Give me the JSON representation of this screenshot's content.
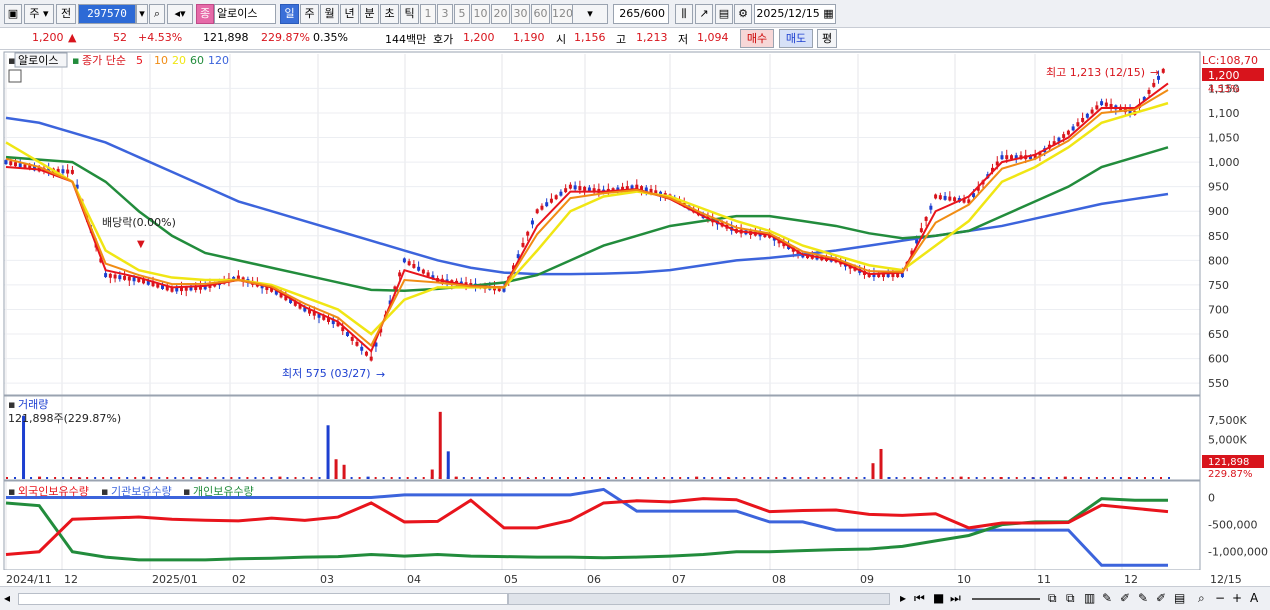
{
  "toolbar": {
    "market": "주",
    "prefix": "전",
    "code": "297570",
    "badge": "종",
    "stock_name": "알로이스",
    "periods": [
      "일",
      "주",
      "월",
      "년",
      "분",
      "초",
      "틱"
    ],
    "active_period": "일",
    "intervals": [
      "1",
      "3",
      "5",
      "10",
      "20",
      "30",
      "60",
      "120"
    ],
    "count": "265",
    "total": "/600",
    "date": "2025/12/15"
  },
  "quote": {
    "price": "1,200",
    "arrow": "▲",
    "change": "52",
    "change_pct": "+4.53%",
    "volume": "121,898",
    "volume_ratio": "229.87%",
    "turnover": "0.35%",
    "amount": "144백만",
    "ask_label": "호가",
    "ask": "1,200",
    "bid": "1,190",
    "open_label": "시",
    "open": "1,156",
    "high_label": "고",
    "high": "1,213",
    "low_label": "저",
    "low": "1,094",
    "buy_label": "매수",
    "sell_label": "매도",
    "eval_label": "평"
  },
  "price_panel": {
    "name": "알로이스",
    "indicator": "종가 단순",
    "ma_periods": [
      "5",
      "10",
      "20",
      "60",
      "120"
    ],
    "ma_colors": [
      "#e8141c",
      "#f08c14",
      "#f0e614",
      "#228c3c",
      "#3c64dc"
    ],
    "lc": "LC:108,70",
    "current": "1,200",
    "current_pct": "4.53%",
    "high_note": "최고 1,213 (12/15)",
    "low_note": "최저 575 (03/27)",
    "dividend_note": "배당락(0.00%)",
    "y_ticks": [
      "1,150",
      "1,100",
      "1,050",
      "1,000",
      "950",
      "900",
      "850",
      "800",
      "750",
      "700",
      "650",
      "600",
      "550"
    ]
  },
  "volume_panel": {
    "title": "거래량",
    "value": "121,898주(229.87%)",
    "y_ticks": [
      "7,500K",
      "5,000K",
      "2,500K"
    ],
    "current": "121,898",
    "current_pct": "229.87%"
  },
  "holdings_panel": {
    "legend": [
      "외국인보유수량",
      "기관보유수량",
      "개인보유수량"
    ],
    "colors": [
      "#e8141c",
      "#3c64dc",
      "#228c3c"
    ],
    "y_ticks": [
      "0",
      "-500,000",
      "-1,000,000"
    ]
  },
  "x_axis": {
    "labels": [
      "2024/11",
      "12",
      "2025/01",
      "02",
      "03",
      "04",
      "05",
      "06",
      "07",
      "08",
      "09",
      "10",
      "11",
      "12"
    ],
    "last": "12/15"
  },
  "chart_data": {
    "type": "line",
    "x_labels": [
      "2024/11",
      "12",
      "2025/01",
      "02",
      "03",
      "04",
      "05",
      "06",
      "07",
      "08",
      "09",
      "10",
      "11",
      "12"
    ],
    "price_ylim": [
      530,
      1220
    ],
    "price": [
      1000,
      985,
      980,
      770,
      760,
      740,
      745,
      765,
      740,
      700,
      670,
      600,
      800,
      760,
      750,
      740,
      900,
      950,
      940,
      950,
      930,
      890,
      860,
      850,
      810,
      800,
      770,
      770,
      930,
      920,
      1010,
      1010,
      1060,
      1120,
      1100,
      1200
    ],
    "ma5": [
      990,
      985,
      960,
      780,
      765,
      745,
      748,
      760,
      745,
      705,
      675,
      615,
      780,
      760,
      748,
      745,
      870,
      940,
      940,
      945,
      925,
      890,
      860,
      852,
      812,
      800,
      772,
      775,
      900,
      930,
      1000,
      1015,
      1050,
      1110,
      1110,
      1160
    ],
    "ma20": [
      1040,
      1000,
      960,
      820,
      780,
      765,
      760,
      760,
      750,
      725,
      700,
      650,
      720,
      745,
      745,
      745,
      820,
      900,
      930,
      940,
      930,
      905,
      880,
      860,
      830,
      810,
      790,
      780,
      830,
      880,
      960,
      990,
      1030,
      1080,
      1100,
      1120
    ],
    "ma60": [
      1010,
      1005,
      1000,
      960,
      900,
      850,
      815,
      800,
      785,
      770,
      755,
      740,
      738,
      742,
      748,
      755,
      770,
      800,
      830,
      850,
      870,
      880,
      890,
      890,
      880,
      870,
      855,
      845,
      850,
      860,
      890,
      920,
      950,
      990,
      1010,
      1030
    ],
    "ma120": [
      1090,
      1080,
      1060,
      1040,
      1010,
      980,
      950,
      920,
      900,
      880,
      860,
      840,
      820,
      800,
      785,
      775,
      772,
      772,
      773,
      775,
      780,
      790,
      800,
      805,
      812,
      820,
      830,
      840,
      850,
      860,
      870,
      885,
      900,
      915,
      925,
      935
    ],
    "volume_ylim": [
      0,
      10000
    ],
    "volume_bars": [
      [
        2,
        8000
      ],
      [
        4,
        300
      ],
      [
        9,
        200
      ],
      [
        17,
        300
      ],
      [
        24,
        200
      ],
      [
        34,
        300
      ],
      [
        40,
        6800
      ],
      [
        41,
        2500
      ],
      [
        42,
        1800
      ],
      [
        45,
        300
      ],
      [
        53,
        1200
      ],
      [
        54,
        8500
      ],
      [
        55,
        3500
      ],
      [
        56,
        300
      ],
      [
        65,
        100
      ],
      [
        75,
        200
      ],
      [
        86,
        300
      ],
      [
        90,
        200
      ],
      [
        97,
        200
      ],
      [
        108,
        2000
      ],
      [
        109,
        3800
      ],
      [
        110,
        250
      ],
      [
        119,
        300
      ],
      [
        124,
        250
      ],
      [
        128,
        220
      ],
      [
        132,
        300
      ],
      [
        140,
        200
      ]
    ],
    "holdings_ylim": [
      -1300000,
      250000
    ],
    "foreign": [
      -1050000,
      -1000000,
      -400000,
      -380000,
      -360000,
      -400000,
      -420000,
      -430000,
      -380000,
      -420000,
      -360000,
      -100000,
      -450000,
      -440000,
      -50000,
      -560000,
      -560000,
      -420000,
      -100000,
      -60000,
      -80000,
      -20000,
      -40000,
      -260000,
      -240000,
      -230000,
      -310000,
      -330000,
      -300000,
      -560000,
      -470000,
      -470000,
      -460000,
      -140000,
      -200000,
      -260000
    ],
    "institution": [
      0,
      0,
      0,
      0,
      0,
      0,
      0,
      0,
      0,
      0,
      0,
      0,
      50000,
      50000,
      50000,
      50000,
      50000,
      50000,
      150000,
      -250000,
      -250000,
      -250000,
      -250000,
      -450000,
      -450000,
      -600000,
      -600000,
      -600000,
      -600000,
      -600000,
      -600000,
      -600000,
      -600000,
      -1250000,
      -1250000,
      -1250000
    ],
    "individual": [
      -100000,
      -150000,
      -1000000,
      -1100000,
      -1150000,
      -1150000,
      -1150000,
      -1130000,
      -1120000,
      -1100000,
      -1090000,
      -1050000,
      -1080000,
      -1050000,
      -1080000,
      -1090000,
      -1100000,
      -1100000,
      -1110000,
      -1100000,
      -1080000,
      -1050000,
      -1000000,
      -1000000,
      -980000,
      -960000,
      -950000,
      -900000,
      -800000,
      -700000,
      -500000,
      -450000,
      -450000,
      -20000,
      -50000,
      -50000
    ]
  }
}
